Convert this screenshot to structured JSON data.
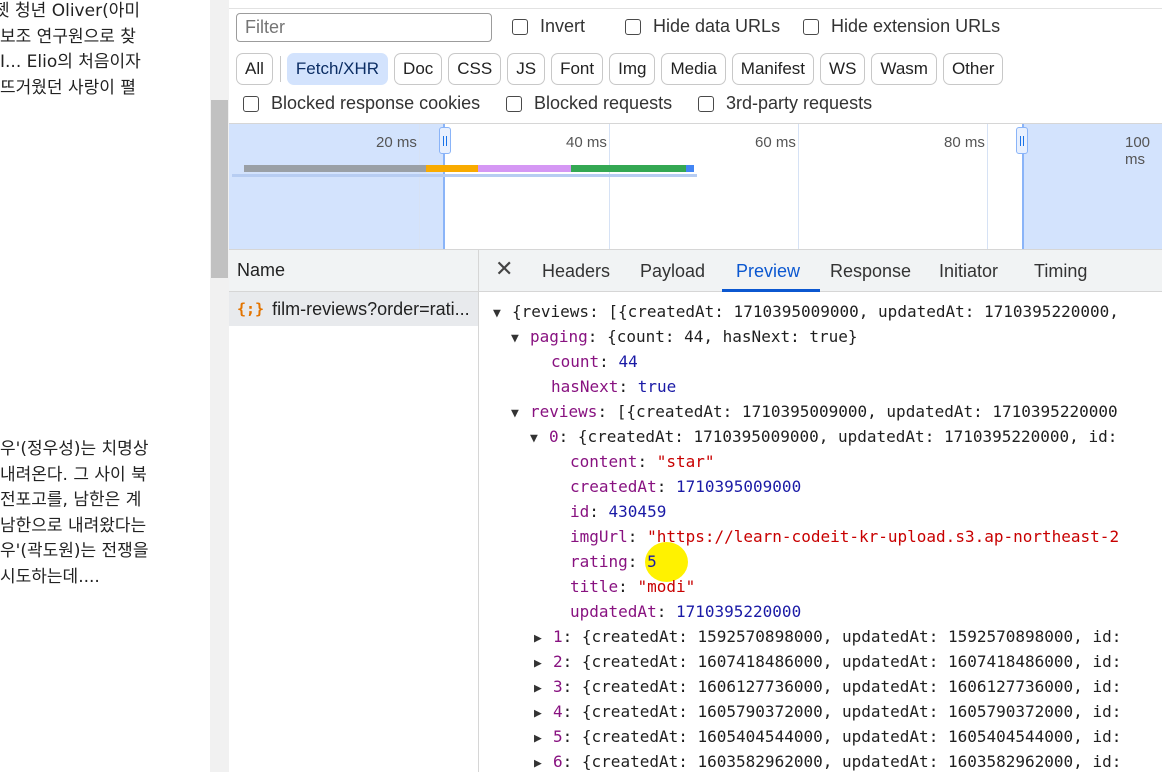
{
  "page": {
    "top_lines": [
      "젯 청년 Oliver(아미",
      "보조 연구원으로 찾",
      "I... Elio의 처음이자",
      "뜨거웠던 사랑이 펼"
    ],
    "bottom_lines": [
      "우'(정우성)는 치명상",
      "내려온다. 그 사이 북",
      "전포고를, 남한은 계",
      "남한으로 내려왔다는",
      "우'(곽도원)는 전쟁을",
      "시도하는데...."
    ]
  },
  "filters": {
    "placeholder": "Filter",
    "invert": "Invert",
    "hide_data_urls": "Hide data URLs",
    "hide_extension_urls": "Hide extension URLs",
    "types": [
      "All",
      "Fetch/XHR",
      "Doc",
      "CSS",
      "JS",
      "Font",
      "Img",
      "Media",
      "Manifest",
      "WS",
      "Wasm",
      "Other"
    ],
    "active_type": "Fetch/XHR",
    "blocked_cookies": "Blocked response cookies",
    "blocked_requests": "Blocked requests",
    "third_party": "3rd-party requests"
  },
  "overview": {
    "ticks": [
      "20 ms",
      "40 ms",
      "60 ms",
      "80 ms",
      "100 ms"
    ],
    "bar_colors": {
      "queue": "#9aa0a6",
      "stall": "#f9ab00",
      "ttfb": "#d597f4",
      "download": "#34a853",
      "end": "#4285f4"
    }
  },
  "requests": {
    "header": "Name",
    "items": [
      {
        "name": "film-reviews?order=rati...",
        "icon": "xhr-icon"
      }
    ]
  },
  "tabs": {
    "close": "✕",
    "items": [
      "Headers",
      "Payload",
      "Preview",
      "Response",
      "Initiator",
      "Timing"
    ],
    "active": "Preview"
  },
  "preview": {
    "l0": "{reviews: [{createdAt: 1710395009000, updatedAt: 1710395220000,",
    "paging_key": "paging",
    "paging_val": "{count: 44, hasNext: true}",
    "count_key": "count",
    "count_val": "44",
    "hasnext_key": "hasNext",
    "hasnext_val": "true",
    "reviews_key": "reviews",
    "reviews_val": "[{createdAt: 1710395009000, updatedAt: 1710395220000",
    "item0_key": "0",
    "item0_val": "{createdAt: 1710395009000, updatedAt: 1710395220000, id:",
    "content_key": "content",
    "content_val": "\"star\"",
    "createdAt_key": "createdAt",
    "createdAt_val": "1710395009000",
    "id_key": "id",
    "id_val": "430459",
    "imgUrl_key": "imgUrl",
    "imgUrl_val": "\"https://learn-codeit-kr-upload.s3.ap-northeast-2",
    "rating_key": "rating",
    "rating_val": "5",
    "title_key": "title",
    "title_val": "\"modi\"",
    "updatedAt_key": "updatedAt",
    "updatedAt_val": "1710395220000",
    "collapsed": [
      {
        "idx": "1",
        "val": "{createdAt: 1592570898000, updatedAt: 1592570898000, id:"
      },
      {
        "idx": "2",
        "val": "{createdAt: 1607418486000, updatedAt: 1607418486000, id:"
      },
      {
        "idx": "3",
        "val": "{createdAt: 1606127736000, updatedAt: 1606127736000, id:"
      },
      {
        "idx": "4",
        "val": "{createdAt: 1605790372000, updatedAt: 1605790372000, id:"
      },
      {
        "idx": "5",
        "val": "{createdAt: 1605404544000, updatedAt: 1605404544000, id:"
      },
      {
        "idx": "6",
        "val": "{createdAt: 1603582962000, updatedAt: 1603582962000, id:"
      }
    ]
  }
}
